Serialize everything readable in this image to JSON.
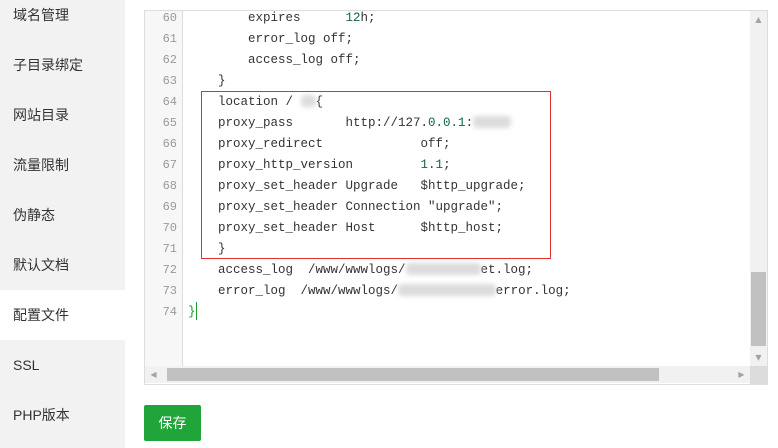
{
  "sidebar": {
    "items": [
      {
        "label": "域名管理"
      },
      {
        "label": "子目录绑定"
      },
      {
        "label": "网站目录"
      },
      {
        "label": "流量限制"
      },
      {
        "label": "伪静态"
      },
      {
        "label": "默认文档"
      },
      {
        "label": "配置文件",
        "active": true
      },
      {
        "label": "SSL"
      },
      {
        "label": "PHP版本"
      }
    ]
  },
  "editor": {
    "line_numbers": [
      "60",
      "61",
      "62",
      "63",
      "64",
      "65",
      "66",
      "67",
      "68",
      "69",
      "70",
      "71",
      "72",
      "73",
      "74"
    ],
    "lines": [
      [
        "        expires      ",
        "12",
        "h;"
      ],
      [
        "        error_log off;"
      ],
      [
        "        access_log off;"
      ],
      [
        "    }"
      ],
      [
        "    location / ",
        "{"
      ],
      [
        "    proxy_pass       http://127.",
        "0.0.1",
        ":"
      ],
      [
        "    proxy_redirect             off;"
      ],
      [
        "    proxy_http_version         ",
        "1.1",
        ";"
      ],
      [
        "    proxy_set_header Upgrade   $http_upgrade;"
      ],
      [
        "    proxy_set_header Connection \"upgrade\";"
      ],
      [
        "    proxy_set_header Host      $http_host;"
      ],
      [
        "    }"
      ],
      [
        "    access_log  /www/wwwlogs/",
        "et.log;"
      ],
      [
        "    error_log  /www/wwwlogs/",
        "error.log;"
      ],
      [
        "}"
      ]
    ],
    "scrollbar_icons": {
      "up": "▲",
      "down": "▼",
      "left": "◀",
      "right": "▶"
    }
  },
  "save_button": {
    "label": "保存"
  },
  "colors": {
    "accent": "#20a53a",
    "highlight_box": "#e0302f",
    "number": "#116644",
    "bracket_match": "#1a9b2e"
  }
}
